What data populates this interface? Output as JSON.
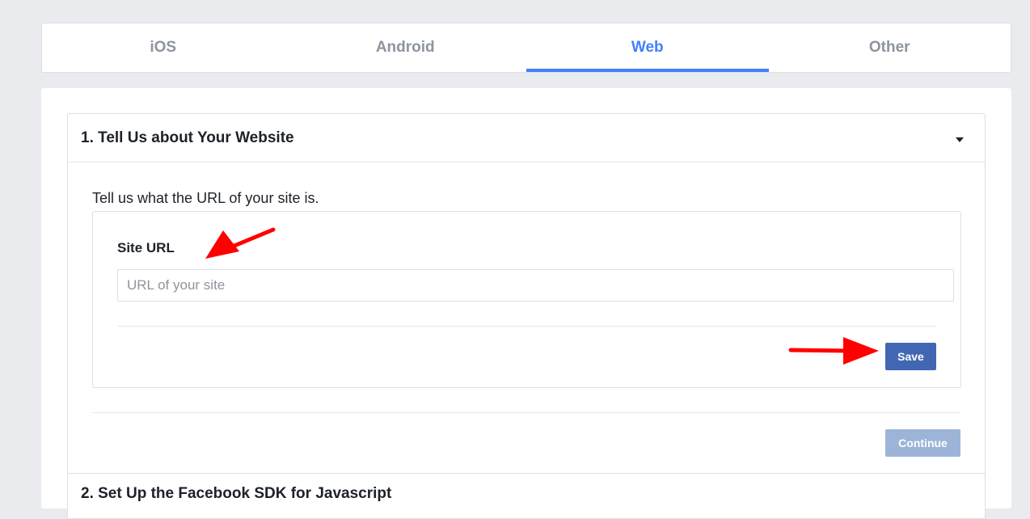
{
  "tabs": [
    {
      "label": "iOS",
      "active": false
    },
    {
      "label": "Android",
      "active": false
    },
    {
      "label": "Web",
      "active": true
    },
    {
      "label": "Other",
      "active": false
    }
  ],
  "section": {
    "title": "1. Tell Us about Your Website",
    "caret_icon": "caret-down-icon",
    "intro": "Tell us what the URL of your site is.",
    "field_label": "Site URL",
    "url_placeholder": "URL of your site",
    "url_value": "",
    "save_label": "Save",
    "continue_label": "Continue"
  },
  "next_section": {
    "title": "2. Set Up the Facebook SDK for Javascript"
  },
  "annotations": {
    "arrow_color": "#ff0000",
    "arrow_icon": "red-arrow-annotation"
  },
  "colors": {
    "accent": "#4080ff",
    "button_primary": "#4267b2",
    "button_disabled": "#9cb4d8",
    "page_bg": "#e9ebee"
  }
}
